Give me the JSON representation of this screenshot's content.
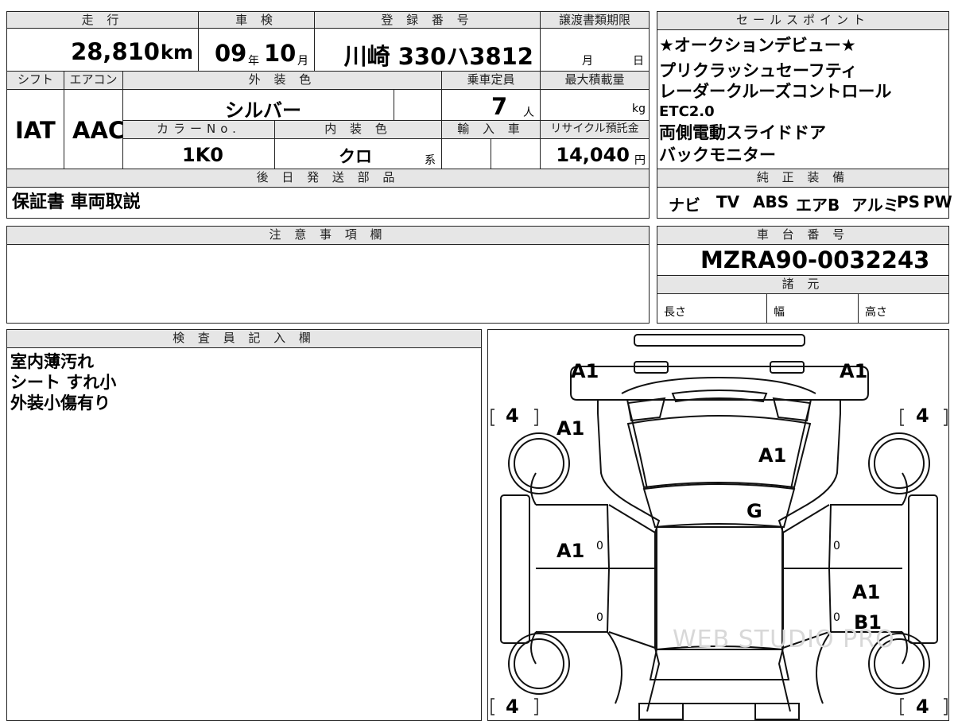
{
  "top_row": {
    "mileage_label": "走 行",
    "mileage_value": "28,810",
    "mileage_unit": "km",
    "inspection_label": "車 検",
    "inspection_year": "09",
    "inspection_year_unit": "年",
    "inspection_month": "10",
    "inspection_month_unit": "月",
    "reg_label": "登 録 番 号",
    "reg_value": "川崎 330ハ3812",
    "transfer_label": "譲渡書類期限",
    "transfer_month_unit": "月",
    "transfer_day_unit": "日"
  },
  "second_row": {
    "shift_label": "シフト",
    "aircon_label": "エアコン",
    "exterior_label": "外 装 色",
    "capacity_label": "乗車定員",
    "max_load_label": "最大積載量",
    "shift_value": "IAT",
    "aircon_value": "AAC",
    "exterior_value": "シルバー",
    "capacity_value": "7",
    "capacity_unit": "人",
    "max_load_unit": "kg",
    "color_no_label": "カラーNo.",
    "interior_label": "内 装 色",
    "import_label": "輸 入 車",
    "recycle_label": "リサイクル預託金",
    "color_no_value": "1K0",
    "interior_value": "クロ",
    "interior_unit": "系",
    "recycle_value": "14,040",
    "recycle_unit": "円"
  },
  "later_parts": {
    "label": "後 日 発 送 部 品",
    "value": "保証書 車両取説"
  },
  "sales_points": {
    "label": "セールスポイント",
    "items": [
      "★オークションデビュー★",
      "プリクラッシュセーフティ",
      "レーダークルーズコントロール",
      "ETC2.0",
      "両側電動スライドドア",
      "バックモニター"
    ]
  },
  "equipment": {
    "label": "純 正 装 備",
    "items": [
      "ナビ",
      "TV",
      "ABS",
      "エアB",
      "アルミ",
      "PS",
      "PW"
    ]
  },
  "notes": {
    "label": "注 意 事 項 欄"
  },
  "chassis": {
    "label": "車 台 番 号",
    "value": "MZRA90-0032243"
  },
  "specs": {
    "label": "諸 元",
    "length_label": "長さ",
    "width_label": "幅",
    "height_label": "高さ"
  },
  "inspector": {
    "label": "検 査 員 記 入 欄",
    "lines": [
      "室内薄汚れ",
      "シート すれ小",
      "外装小傷有り"
    ]
  },
  "diagram": {
    "marks": {
      "front_left": "A1",
      "front_right": "A1",
      "hood": "A1",
      "left_fender": "A1",
      "windshield": "G",
      "left_door": "A1",
      "right_rear_door": "A1",
      "right_rear_door_2": "B1"
    },
    "tires": [
      "4",
      "4",
      "4",
      "4"
    ],
    "zero": "0",
    "watermark": "WEB STUDIO PRO"
  }
}
